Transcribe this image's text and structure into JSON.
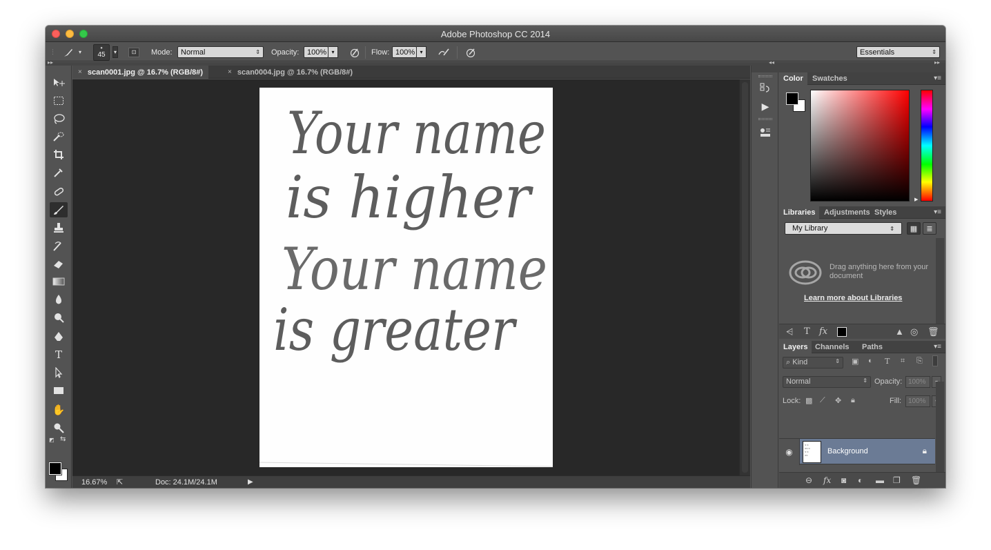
{
  "window": {
    "title": "Adobe Photoshop CC 2014"
  },
  "options_bar": {
    "brush_size": "45",
    "mode_label": "Mode:",
    "mode_value": "Normal",
    "opacity_label": "Opacity:",
    "opacity_value": "100%",
    "flow_label": "Flow:",
    "flow_value": "100%",
    "workspace": "Essentials"
  },
  "tabs": [
    {
      "label": "scan0001.jpg @ 16.7% (RGB/8#)",
      "active": true
    },
    {
      "label": "scan0004.jpg @ 16.7% (RGB/8#)",
      "active": false
    }
  ],
  "document": {
    "handwriting": [
      "Your name",
      "is higher",
      "Your name",
      "is greater"
    ]
  },
  "status_bar": {
    "zoom": "16.67%",
    "doc_size": "Doc: 24.1M/24.1M"
  },
  "color_panel": {
    "tabs": [
      "Color",
      "Swatches"
    ],
    "foreground": "#000000",
    "background": "#ffffff"
  },
  "libraries_panel": {
    "tabs": [
      "Libraries",
      "Adjustments",
      "Styles"
    ],
    "library": "My Library",
    "hint": "Drag anything here from your document",
    "link": "Learn more about Libraries"
  },
  "layers_panel": {
    "tabs": [
      "Layers",
      "Channels",
      "Paths"
    ],
    "kind": "Kind",
    "blend_mode": "Normal",
    "opacity_label": "Opacity:",
    "opacity_value": "100%",
    "lock_label": "Lock:",
    "fill_label": "Fill:",
    "fill_value": "100%",
    "layers": [
      {
        "name": "Background",
        "locked": true,
        "visible": true
      }
    ]
  },
  "icons": {
    "toolbar": [
      "move-icon",
      "marquee-icon",
      "lasso-icon",
      "quick-select-icon",
      "crop-icon",
      "eyedropper-icon",
      "healing-brush-icon",
      "brush-icon",
      "clone-stamp-icon",
      "history-brush-icon",
      "eraser-icon",
      "gradient-icon",
      "blur-icon",
      "dodge-icon",
      "pen-icon",
      "type-icon",
      "path-select-icon",
      "rectangle-icon",
      "hand-icon",
      "zoom-icon"
    ]
  },
  "colors": {
    "panel_bg": "#535353",
    "canvas_bg": "#282828",
    "selected_layer": "#6b7b95"
  }
}
